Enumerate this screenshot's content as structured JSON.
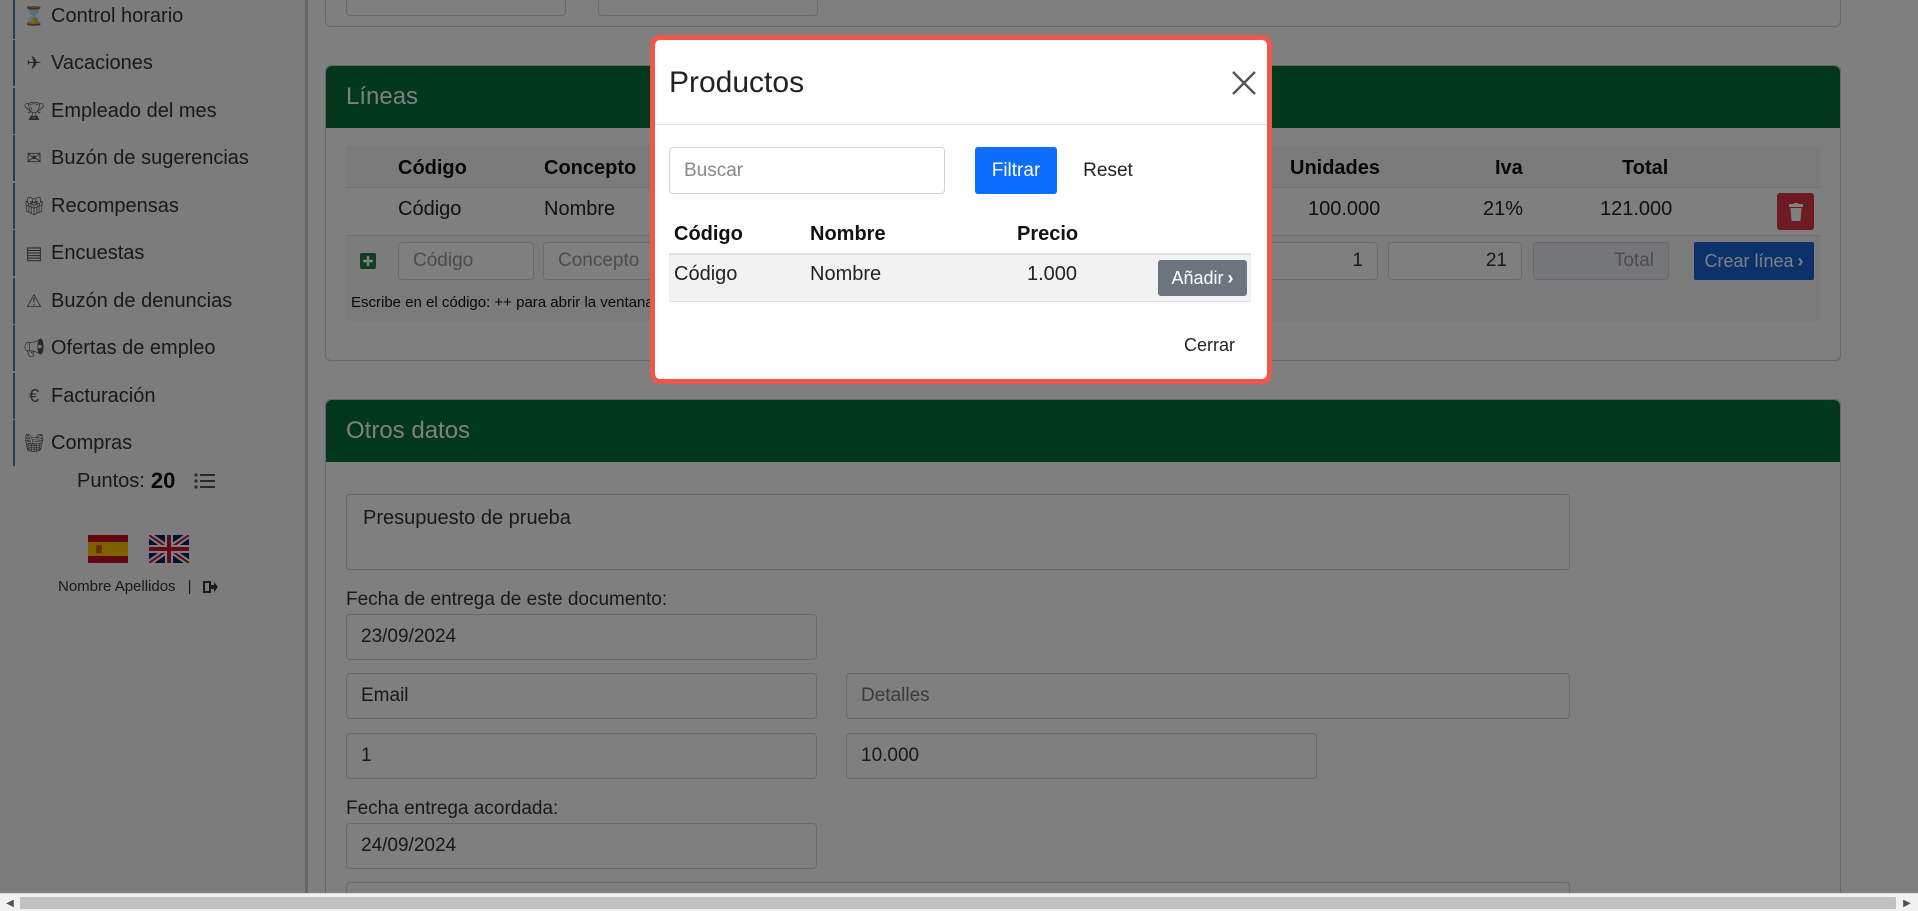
{
  "sidebar": {
    "items": [
      {
        "label": "Control horario",
        "icon": "hourglass-icon"
      },
      {
        "label": "Vacaciones",
        "icon": "plane-icon"
      },
      {
        "label": "Empleado del mes",
        "icon": "trophy-icon"
      },
      {
        "label": "Buzón de sugerencias",
        "icon": "inbox-icon"
      },
      {
        "label": "Recompensas",
        "icon": "gift-icon"
      },
      {
        "label": "Encuestas",
        "icon": "clipboard-icon"
      },
      {
        "label": "Buzón de denuncias",
        "icon": "warning-icon"
      },
      {
        "label": "Ofertas de empleo",
        "icon": "megaphone-icon"
      },
      {
        "label": "Facturación",
        "icon": "euro-icon"
      },
      {
        "label": "Compras",
        "icon": "basket-icon"
      }
    ],
    "points_label": "Puntos:",
    "points_value": "20",
    "user_name": "Nombre Apellidos",
    "user_sep": "|"
  },
  "lineas": {
    "title": "Líneas",
    "headers": {
      "codigo": "Código",
      "concepto": "Concepto",
      "unidades": "Unidades",
      "iva": "Iva",
      "total": "Total"
    },
    "row": {
      "codigo": "Código",
      "concepto": "Nombre",
      "unidades": "100.000",
      "iva": "21%",
      "total": "121.000"
    },
    "new_row": {
      "codigo_ph": "Código",
      "concepto_ph": "Concepto",
      "unidades": "1",
      "iva": "21",
      "total_ph": "Total",
      "create_label": "Crear línea"
    },
    "hint": "Escribe en el código: ++ para abrir la ventana"
  },
  "otros": {
    "title": "Otros datos",
    "observaciones": "Presupuesto de prueba",
    "fecha_entrega_label": "Fecha de entrega de este documento:",
    "fecha_entrega": "23/09/2024",
    "email": "Email",
    "detalles_ph": "Detalles",
    "field_1": "1",
    "field_10000": "10.000",
    "fecha_acordada_label": "Fecha entrega acordada:",
    "fecha_acordada": "24/09/2024"
  },
  "modal": {
    "title": "Productos",
    "search_placeholder": "Buscar",
    "filter_label": "Filtrar",
    "reset_label": "Reset",
    "headers": {
      "codigo": "Código",
      "nombre": "Nombre",
      "precio": "Precio"
    },
    "rows": [
      {
        "codigo": "Código",
        "nombre": "Nombre",
        "precio": "1.000",
        "action": "Añadir"
      }
    ],
    "close_label": "Cerrar"
  },
  "colors": {
    "card_header": "#006e3a",
    "primary": "#0d6efd",
    "danger": "#dc3545",
    "secondary": "#6c757d",
    "modal_border": "#f0564a"
  }
}
